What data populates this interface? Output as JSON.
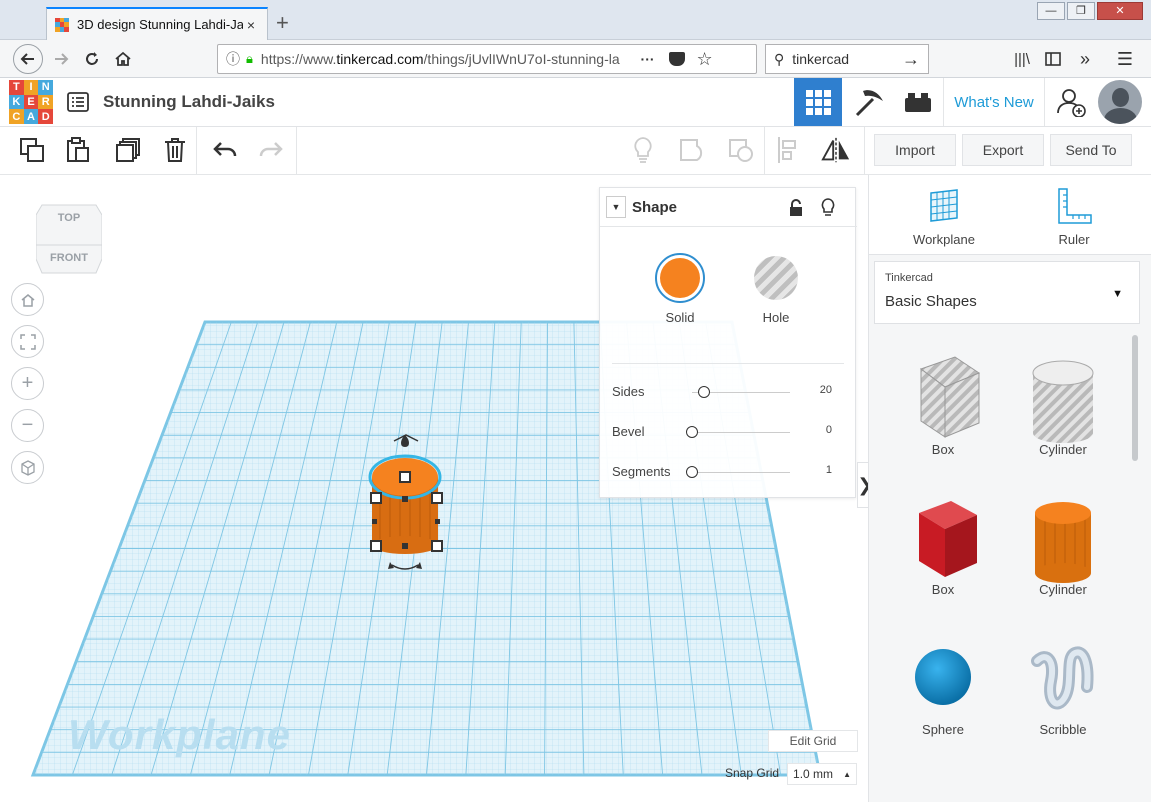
{
  "browser": {
    "tab_title": "3D design Stunning Lahdi-Jaiks",
    "tab_close": "×",
    "new_tab": "+",
    "url_scheme": "https://www.",
    "url_host": "tinkercad.com",
    "url_path": "/things/jUvlIWnU7oI-stunning-la",
    "url_menu": "···",
    "search_value": "tinkercad",
    "win_min": "—",
    "win_max": "❐",
    "win_close": "✕"
  },
  "app": {
    "logo_letters": [
      "T",
      "I",
      "N",
      "K",
      "E",
      "R",
      "C",
      "A",
      "D"
    ],
    "logo_colors": [
      "#e5473a",
      "#f0a325",
      "#45a9dd",
      "#45a9dd",
      "#e5473a",
      "#f0a325",
      "#f0a325",
      "#45a9dd",
      "#e5473a"
    ],
    "design_title": "Stunning Lahdi-Jaiks",
    "whats_new": "What's New",
    "accent": "#1e9bd7"
  },
  "toolbar": {
    "import": "Import",
    "export": "Export",
    "send_to": "Send To"
  },
  "viewcube": {
    "top": "TOP",
    "front": "FRONT"
  },
  "workplane_label": "Workplane",
  "shape_panel": {
    "title": "Shape",
    "solid": "Solid",
    "hole": "Hole",
    "solid_color": "#f5821f",
    "params": [
      {
        "label": "Sides",
        "value": "20",
        "knob": 0.12
      },
      {
        "label": "Bevel",
        "value": "0",
        "knob": 0.0
      },
      {
        "label": "Segments",
        "value": "1",
        "knob": 0.0
      }
    ]
  },
  "grid_controls": {
    "edit_grid": "Edit Grid",
    "snap_label": "Snap Grid",
    "snap_value": "1.0 mm"
  },
  "right_panel": {
    "workplane": "Workplane",
    "ruler": "Ruler",
    "lib_source": "Tinkercad",
    "lib_name": "Basic Shapes",
    "shapes": [
      {
        "label": "Box"
      },
      {
        "label": "Cylinder"
      },
      {
        "label": "Box"
      },
      {
        "label": "Cylinder"
      },
      {
        "label": "Sphere"
      },
      {
        "label": "Scribble"
      }
    ]
  }
}
